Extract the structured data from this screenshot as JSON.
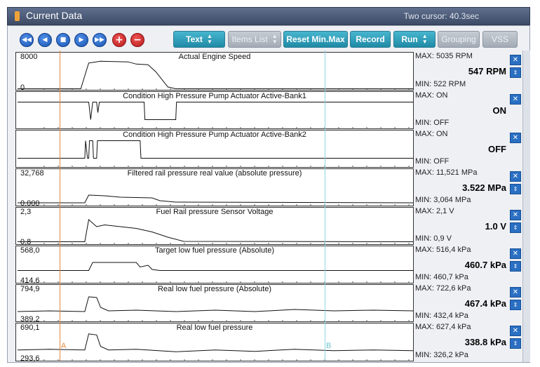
{
  "window": {
    "title": "Current Data",
    "status": "Two cursor: 40.3sec"
  },
  "nav_icons": [
    "rewind-icon",
    "prev-icon",
    "stop-icon",
    "next-icon",
    "fast-forward-icon",
    "plus-icon",
    "minus-icon"
  ],
  "nav_glyphs": [
    "◀◀",
    "◀",
    "■",
    "▶",
    "▶▶",
    "+",
    "−"
  ],
  "toolbar": {
    "text": "Text",
    "items_list": "Items List",
    "reset": "Reset Min.Max",
    "record": "Record",
    "run": "Run",
    "grouping": "Grouping",
    "vss": "VSS"
  },
  "cursor_labels": {
    "a": "A",
    "b": "B"
  },
  "panels": [
    {
      "title": "Actual Engine Speed",
      "ytop": "8000",
      "ybot": "0",
      "max": "MAX:  5035 RPM",
      "cur": "547 RPM",
      "min": "MIN:  522 RPM",
      "points": [
        [
          0,
          0.97
        ],
        [
          0.16,
          0.97
        ],
        [
          0.18,
          0.25
        ],
        [
          0.21,
          0.2
        ],
        [
          0.28,
          0.22
        ],
        [
          0.3,
          0.28
        ],
        [
          0.33,
          0.3
        ],
        [
          0.35,
          0.5
        ],
        [
          0.38,
          0.92
        ],
        [
          0.4,
          0.97
        ],
        [
          1,
          0.97
        ]
      ]
    },
    {
      "title": "Condition High Pressure Pump Actuator Active-Bank1",
      "ytop": "",
      "ybot": "",
      "max": "MAX: ON",
      "cur": "ON",
      "min": "MIN: OFF",
      "points": [
        [
          0,
          0.25
        ],
        [
          0.18,
          0.25
        ],
        [
          0.185,
          0.75
        ],
        [
          0.19,
          0.25
        ],
        [
          0.2,
          0.25
        ],
        [
          0.203,
          0.55
        ],
        [
          0.207,
          0.25
        ],
        [
          0.32,
          0.25
        ],
        [
          0.322,
          0.75
        ],
        [
          0.4,
          0.75
        ],
        [
          0.402,
          0.25
        ],
        [
          1,
          0.25
        ]
      ]
    },
    {
      "title": "Condition High Pressure Pump Actuator Active-Bank2",
      "ytop": "",
      "ybot": "",
      "max": "MAX: ON",
      "cur": "OFF",
      "min": "MIN: OFF",
      "points": [
        [
          0,
          0.75
        ],
        [
          0.17,
          0.75
        ],
        [
          0.172,
          0.25
        ],
        [
          0.177,
          0.75
        ],
        [
          0.18,
          0.75
        ],
        [
          0.182,
          0.25
        ],
        [
          0.19,
          0.25
        ],
        [
          0.192,
          0.75
        ],
        [
          0.2,
          0.75
        ],
        [
          0.202,
          0.25
        ],
        [
          0.31,
          0.25
        ],
        [
          0.312,
          0.75
        ],
        [
          1,
          0.75
        ]
      ]
    },
    {
      "title": "Filtered rail pressure real value (absolute pressure)",
      "ytop": "32,768",
      "ybot": "0.000",
      "max": "MAX: 11,521 MPa",
      "cur": "3.522 MPa",
      "min": "MIN: 3,064 MPa",
      "points": [
        [
          0,
          0.92
        ],
        [
          0.17,
          0.92
        ],
        [
          0.18,
          0.7
        ],
        [
          0.22,
          0.72
        ],
        [
          0.26,
          0.76
        ],
        [
          0.34,
          0.78
        ],
        [
          0.36,
          0.86
        ],
        [
          0.4,
          0.9
        ],
        [
          1,
          0.92
        ]
      ]
    },
    {
      "title": "Fuel Rail pressure Sensor Voltage",
      "ytop": "2,3",
      "ybot": "0,8",
      "max": "MAX:   2,1 V",
      "cur": "1.0 V",
      "min": "MIN:   0,9 V",
      "points": [
        [
          0,
          0.93
        ],
        [
          0.17,
          0.93
        ],
        [
          0.18,
          0.3
        ],
        [
          0.2,
          0.5
        ],
        [
          0.22,
          0.45
        ],
        [
          0.26,
          0.5
        ],
        [
          0.3,
          0.55
        ],
        [
          0.34,
          0.65
        ],
        [
          0.38,
          0.8
        ],
        [
          0.42,
          0.92
        ],
        [
          1,
          0.93
        ]
      ]
    },
    {
      "title": "Target low fuel pressure (Absolute)",
      "ytop": "568,0",
      "ybot": "414,6",
      "max": "MAX: 516,4 kPa",
      "cur": "460.7 kPa",
      "min": "MIN: 460,7 kPa",
      "points": [
        [
          0,
          0.65
        ],
        [
          0.18,
          0.65
        ],
        [
          0.19,
          0.42
        ],
        [
          0.3,
          0.42
        ],
        [
          0.31,
          0.55
        ],
        [
          0.33,
          0.5
        ],
        [
          0.34,
          0.62
        ],
        [
          0.36,
          0.65
        ],
        [
          1,
          0.65
        ]
      ]
    },
    {
      "title": "Real low fuel pressure (Absolute)",
      "ytop": "794,9",
      "ybot": "389,2",
      "max": "MAX: 722,6 kPa",
      "cur": "467.4 kPa",
      "min": "MIN: 432,4 kPa",
      "points": [
        [
          0,
          0.72
        ],
        [
          0.08,
          0.7
        ],
        [
          0.17,
          0.72
        ],
        [
          0.18,
          0.3
        ],
        [
          0.2,
          0.32
        ],
        [
          0.21,
          0.6
        ],
        [
          0.23,
          0.7
        ],
        [
          0.3,
          0.68
        ],
        [
          0.4,
          0.72
        ],
        [
          0.5,
          0.68
        ],
        [
          0.6,
          0.72
        ],
        [
          0.7,
          0.66
        ],
        [
          0.8,
          0.7
        ],
        [
          0.9,
          0.68
        ],
        [
          1,
          0.7
        ]
      ]
    },
    {
      "title": "Real low fuel pressure",
      "ytop": "690,1",
      "ybot": "293,6",
      "max": "MAX: 627,4 kPa",
      "cur": "338.8 kPa",
      "min": "MIN: 326,2 kPa",
      "points": [
        [
          0,
          0.7
        ],
        [
          0.08,
          0.68
        ],
        [
          0.17,
          0.7
        ],
        [
          0.18,
          0.25
        ],
        [
          0.2,
          0.28
        ],
        [
          0.21,
          0.6
        ],
        [
          0.23,
          0.7
        ],
        [
          0.3,
          0.68
        ],
        [
          0.4,
          0.75
        ],
        [
          0.5,
          0.7
        ],
        [
          0.6,
          0.74
        ],
        [
          0.7,
          0.68
        ],
        [
          0.8,
          0.72
        ],
        [
          0.9,
          0.7
        ],
        [
          1,
          0.72
        ]
      ]
    }
  ]
}
